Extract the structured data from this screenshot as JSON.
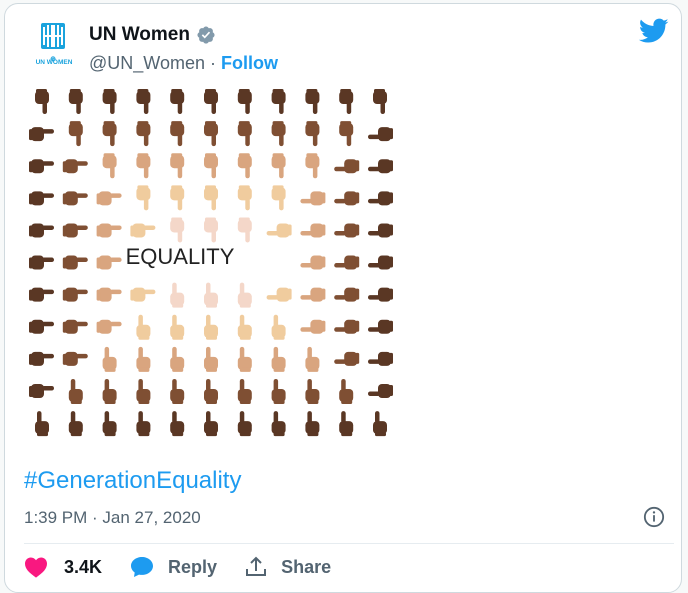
{
  "account": {
    "logo_text": "UN WOMEN",
    "display_name": "UN Women",
    "handle": "@UN_Women",
    "separator": "·",
    "follow_label": "Follow"
  },
  "media": {
    "overlay_text": "EQUALITY",
    "skin_tones": [
      "#f4d7c9",
      "#f0cc9e",
      "#d9a57f",
      "#a9714d",
      "#7f4f33",
      "#5a3724"
    ]
  },
  "tweet": {
    "hashtag": "#GenerationEquality",
    "timestamp": "1:39 PM · Jan 27, 2020"
  },
  "actions": {
    "like_count": "3.4K",
    "reply_label": "Reply",
    "share_label": "Share"
  },
  "colors": {
    "accent": "#1d9bf0",
    "like": "#f91880",
    "logo": "#1aa3dd"
  }
}
